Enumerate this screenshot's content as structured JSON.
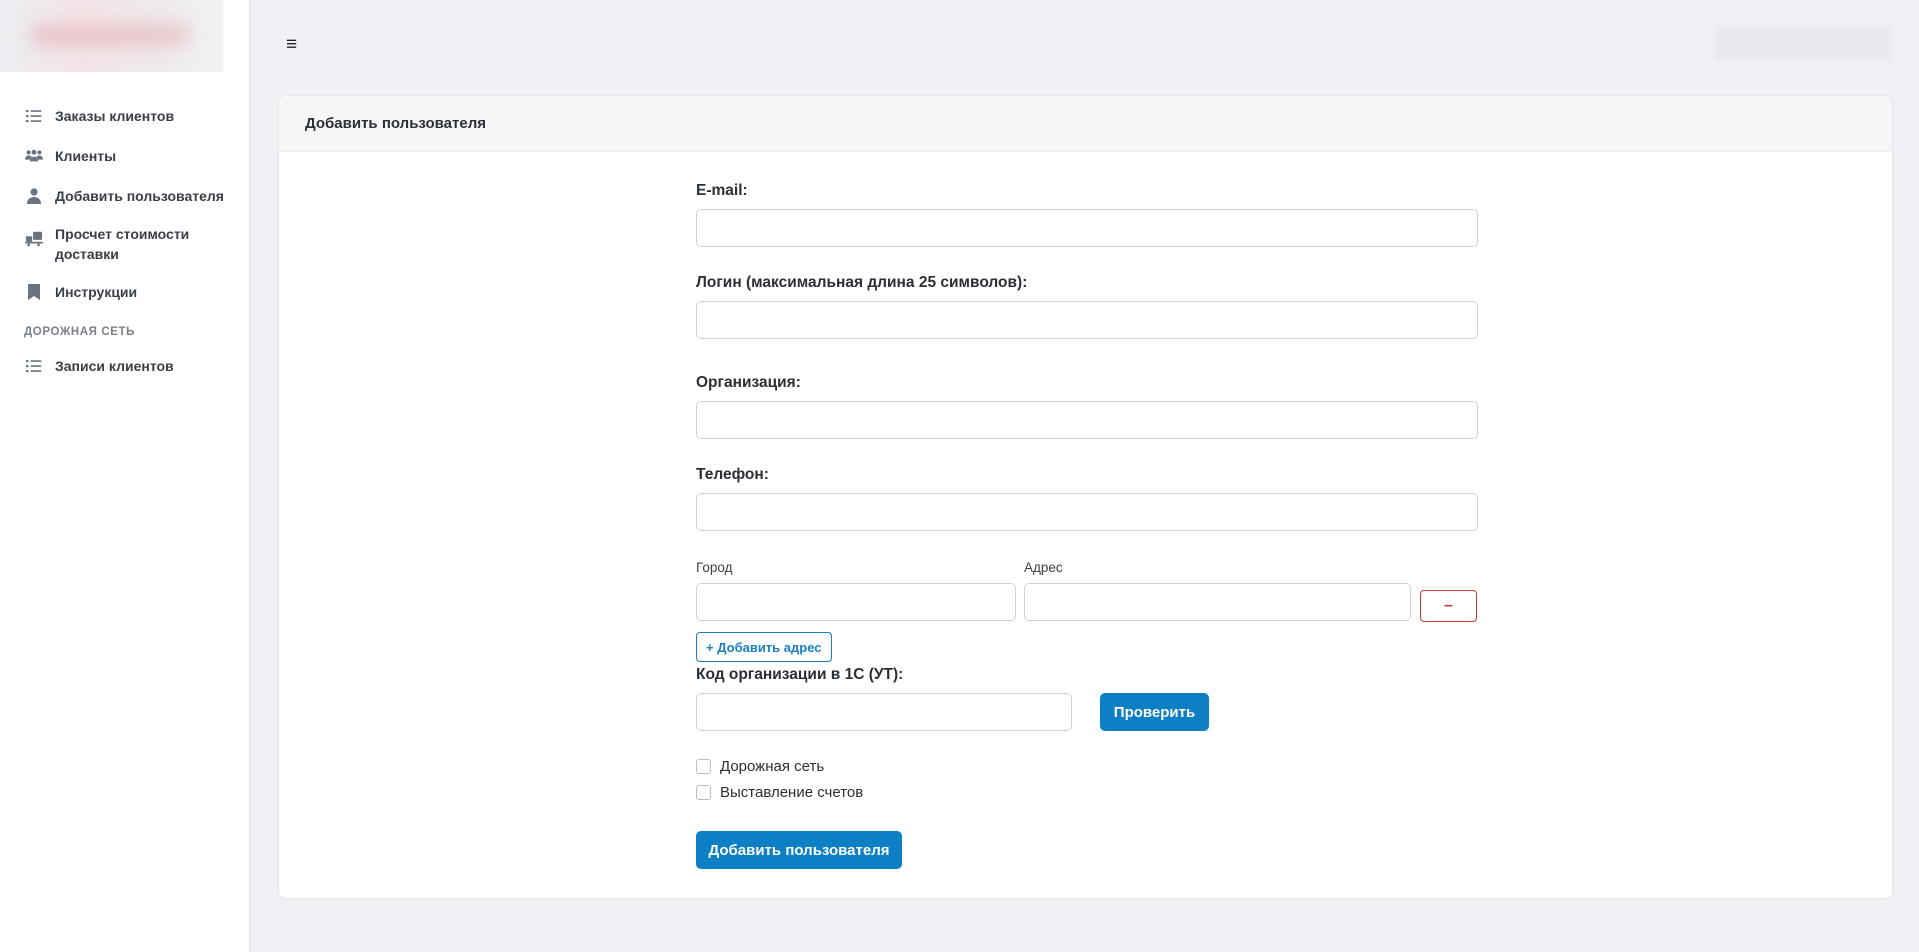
{
  "sidebar": {
    "items": [
      {
        "label": "Заказы клиентов",
        "icon": "list-icon"
      },
      {
        "label": "Клиенты",
        "icon": "users-icon"
      },
      {
        "label": "Добавить пользователя",
        "icon": "user-icon"
      },
      {
        "label": "Просчет стоимости доставки",
        "icon": "delivery-icon"
      },
      {
        "label": "Инструкции",
        "icon": "bookmark-icon"
      }
    ],
    "section_title": "ДОРОЖНАЯ СЕТЬ",
    "section_items": [
      {
        "label": "Записи клиентов",
        "icon": "list-icon"
      }
    ]
  },
  "topbar": {
    "menu_icon": "≡"
  },
  "card": {
    "title": "Добавить пользователя"
  },
  "form": {
    "email_label": "E-mail:",
    "email_value": "",
    "login_label": "Логин (максимальная длина 25 символов):",
    "login_value": "",
    "org_label": "Организация:",
    "org_value": "",
    "phone_label": "Телефон:",
    "phone_value": "",
    "city_label": "Город",
    "city_value": "",
    "address_label": "Адрес",
    "address_value": "",
    "remove_label": "–",
    "add_address_label": "+ Добавить адрес",
    "code_label": "Код организации в 1С (УТ):",
    "code_value": "",
    "check_label": "Проверить",
    "checkbox_road": "Дорожная сеть",
    "checkbox_invoice": "Выставление счетов",
    "submit_label": "Добавить пользователя"
  },
  "colors": {
    "primary": "#0d7fc4",
    "danger": "#c83b3b",
    "background": "#f0f1f5"
  }
}
